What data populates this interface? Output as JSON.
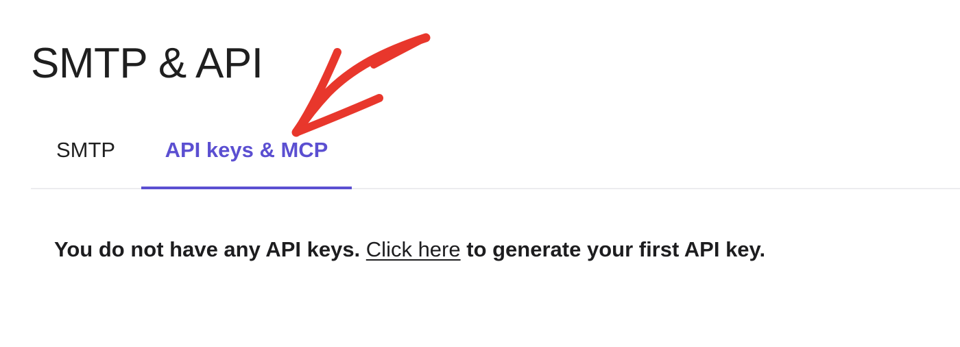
{
  "header": {
    "title": "SMTP & API"
  },
  "tabs": [
    {
      "label": "SMTP",
      "active": false
    },
    {
      "label": "API keys & MCP",
      "active": true
    }
  ],
  "main": {
    "message_before": "You do not have any API keys.",
    "link_label": "Click here",
    "message_after": "to generate your first API key."
  },
  "colors": {
    "accent": "#5b4fd1",
    "annotation": "#e8372c",
    "divider": "#ececef"
  },
  "annotation": {
    "icon": "arrow-annotation-icon"
  }
}
